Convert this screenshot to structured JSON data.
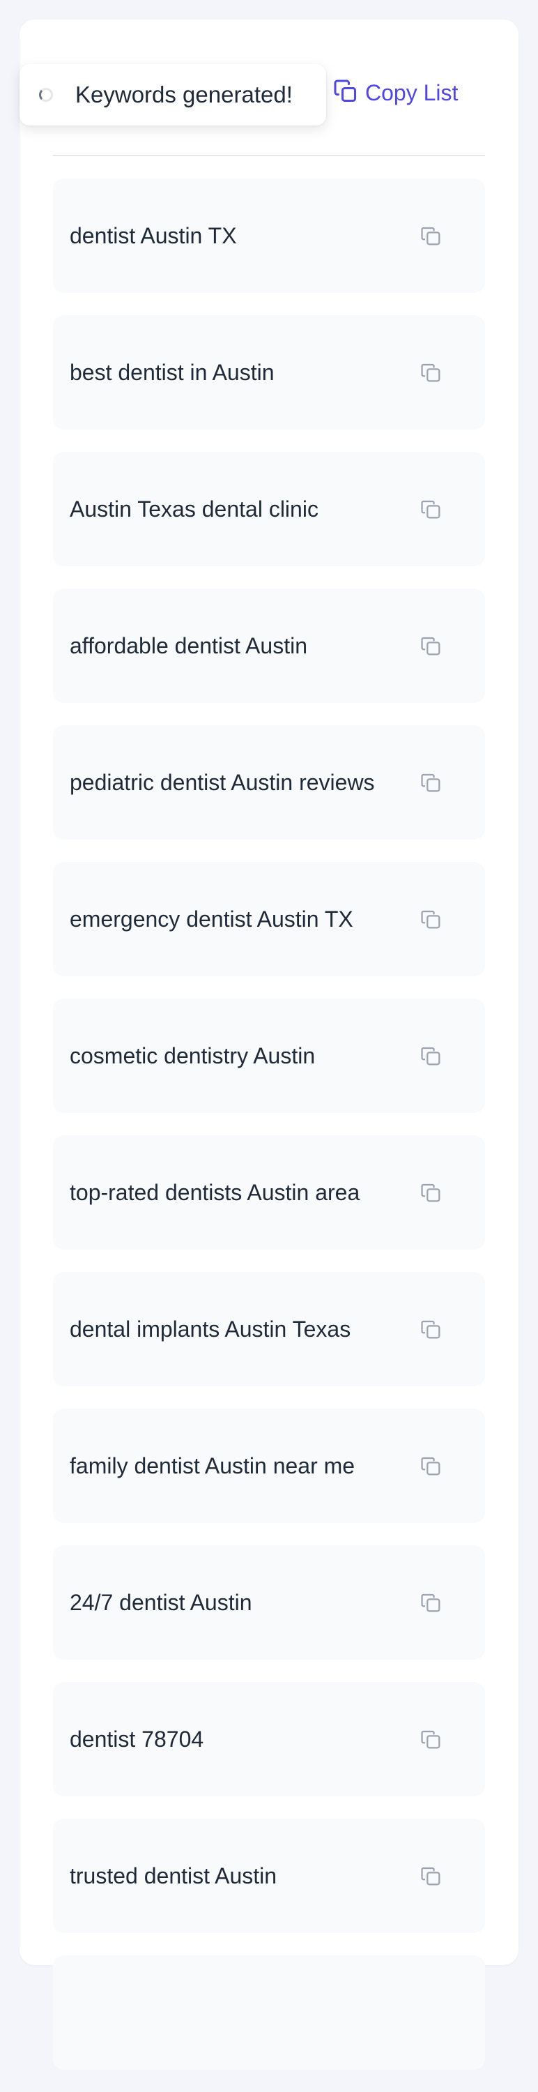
{
  "toast": {
    "message": "Keywords generated!"
  },
  "toolbar": {
    "copy_list_label": "Copy List"
  },
  "colors": {
    "accent": "#4f46e5",
    "text": "#1f2937",
    "icon": "#9ca3af",
    "item_bg": "#f8fafc",
    "divider": "#e5e7eb"
  },
  "keywords": [
    {
      "text": "dentist Austin TX"
    },
    {
      "text": "best dentist in Austin"
    },
    {
      "text": "Austin Texas dental clinic"
    },
    {
      "text": "affordable dentist Austin"
    },
    {
      "text": "pediatric dentist Austin reviews"
    },
    {
      "text": "emergency dentist Austin TX"
    },
    {
      "text": "cosmetic dentistry Austin"
    },
    {
      "text": "top-rated dentists Austin area"
    },
    {
      "text": "dental implants Austin Texas"
    },
    {
      "text": "family dentist Austin near me"
    },
    {
      "text": "24/7 dentist Austin"
    },
    {
      "text": "dentist 78704"
    },
    {
      "text": "trusted dentist Austin"
    }
  ]
}
